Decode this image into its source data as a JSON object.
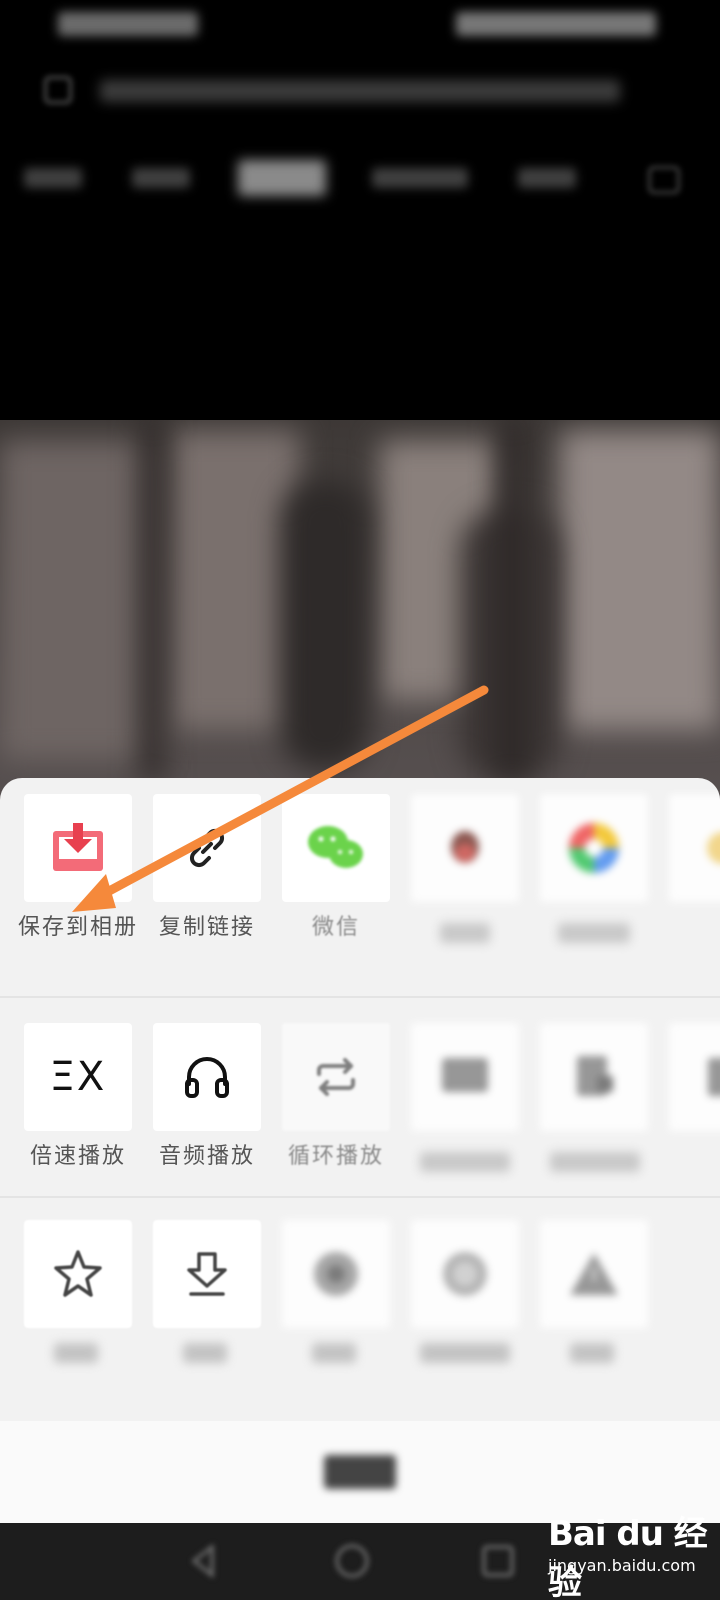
{
  "share_sheet": {
    "row1": [
      {
        "label": "保存到相册",
        "icon": "save-to-album-icon"
      },
      {
        "label": "复制链接",
        "icon": "link-icon"
      },
      {
        "label": "微信",
        "icon": "wechat-icon"
      },
      {
        "label": "",
        "icon": "qq-icon"
      },
      {
        "label": "",
        "icon": "moments-icon"
      }
    ],
    "row2": [
      {
        "label": "倍速播放",
        "icon": "speed-icon",
        "glyph": "ΞX"
      },
      {
        "label": "音频播放",
        "icon": "headphones-icon"
      },
      {
        "label": "循环播放",
        "icon": "loop-icon"
      },
      {
        "label": "",
        "icon": "unknown-icon"
      },
      {
        "label": "",
        "icon": "unknown-icon"
      }
    ],
    "row3": [
      {
        "label": "",
        "icon": "star-icon"
      },
      {
        "label": "",
        "icon": "download-icon"
      },
      {
        "label": "",
        "icon": "unknown-icon"
      },
      {
        "label": "",
        "icon": "unknown-icon"
      },
      {
        "label": "",
        "icon": "warning-icon"
      }
    ]
  },
  "watermark": {
    "logo": "Bai du 经验",
    "url": "jingyan.baidu.com"
  },
  "colors": {
    "arrow": "#f5893b",
    "save_icon_red": "#f04a5a",
    "wechat_green": "#2dc100"
  }
}
